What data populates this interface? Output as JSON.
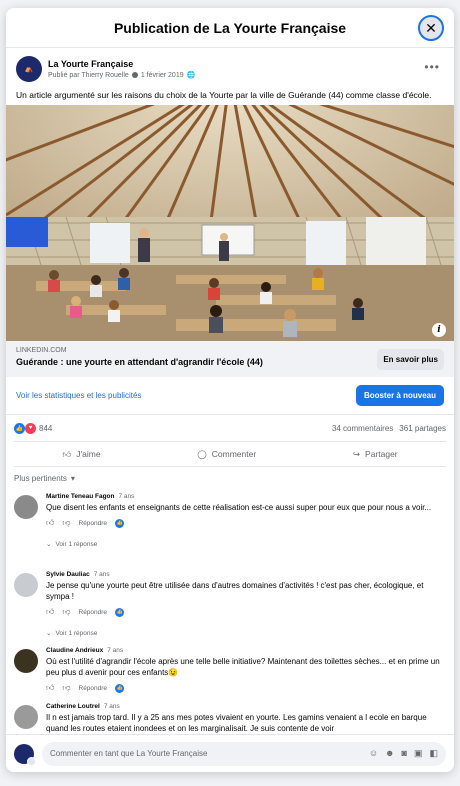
{
  "modal": {
    "title": "Publication de La Yourte Française"
  },
  "post": {
    "page_name": "La Yourte Française",
    "published_by": "Publié par Thierry Rouelle",
    "date": "1 février 2019",
    "text": "Un article argumenté sur les raisons du choix de la Yourte par la ville de Guérande (44) comme classe d'école.",
    "link": {
      "domain": "LINKEDIN.COM",
      "title": "Guérande : une yourte en attendant d'agrandir l'école (44)",
      "button": "En savoir plus"
    }
  },
  "promo": {
    "stats_link": "Voir les statistiques et les publicités",
    "boost_button": "Booster à nouveau"
  },
  "reactions": {
    "count": "844",
    "comments": "34 commentaires",
    "shares": "361 partages"
  },
  "actions": {
    "like": "J'aime",
    "comment": "Commenter",
    "share": "Partager"
  },
  "sort": {
    "label": "Plus pertinents"
  },
  "comments": [
    {
      "author": "Martine Teneau Fagon",
      "time": "7 ans",
      "text": "Que disent les enfants et enseignants de cette réalisation est-ce aussi super pour eux que pour nous a voir...",
      "reply": "Répondre",
      "replies": "Voir 1 réponse",
      "avatar_color": "#8a8a8a"
    },
    {
      "author": "Sylvie Dauliac",
      "time": "7 ans",
      "text": "Je pense qu'une yourte peut être utilisée dans d'autres domaines d'activités ! c'est pas cher, écologique, et sympa !",
      "reply": "Répondre",
      "replies": "Voir 1 réponse",
      "avatar_color": "#c8ccd1"
    },
    {
      "author": "Claudine Andrieux",
      "time": "7 ans",
      "text": "Où est l'utilité d'agrandir l'école après une telle belle initiative? Maintenant des toilettes sèches... et en prime un peu plus d avenir pour ces enfants",
      "emoji": "😉",
      "reply": "Répondre",
      "avatar_color": "#3b3320"
    },
    {
      "author": "Catherine Loutrel",
      "time": "7 ans",
      "text": "Il n est jamais trop tard. Il y a 25 ans mes potes vivaient en yourte. Les gamins venaient a l ecole en barque quand les routes etaient inondees et on les marginalisait. Je suis contente de voir",
      "avatar_color": "#9a9a9a"
    }
  ],
  "composer": {
    "placeholder": "Commenter en tant que La Yourte Française"
  },
  "colors": {
    "brand": "#1b74e4",
    "like": "#1877f2",
    "love": "#f33e58"
  }
}
